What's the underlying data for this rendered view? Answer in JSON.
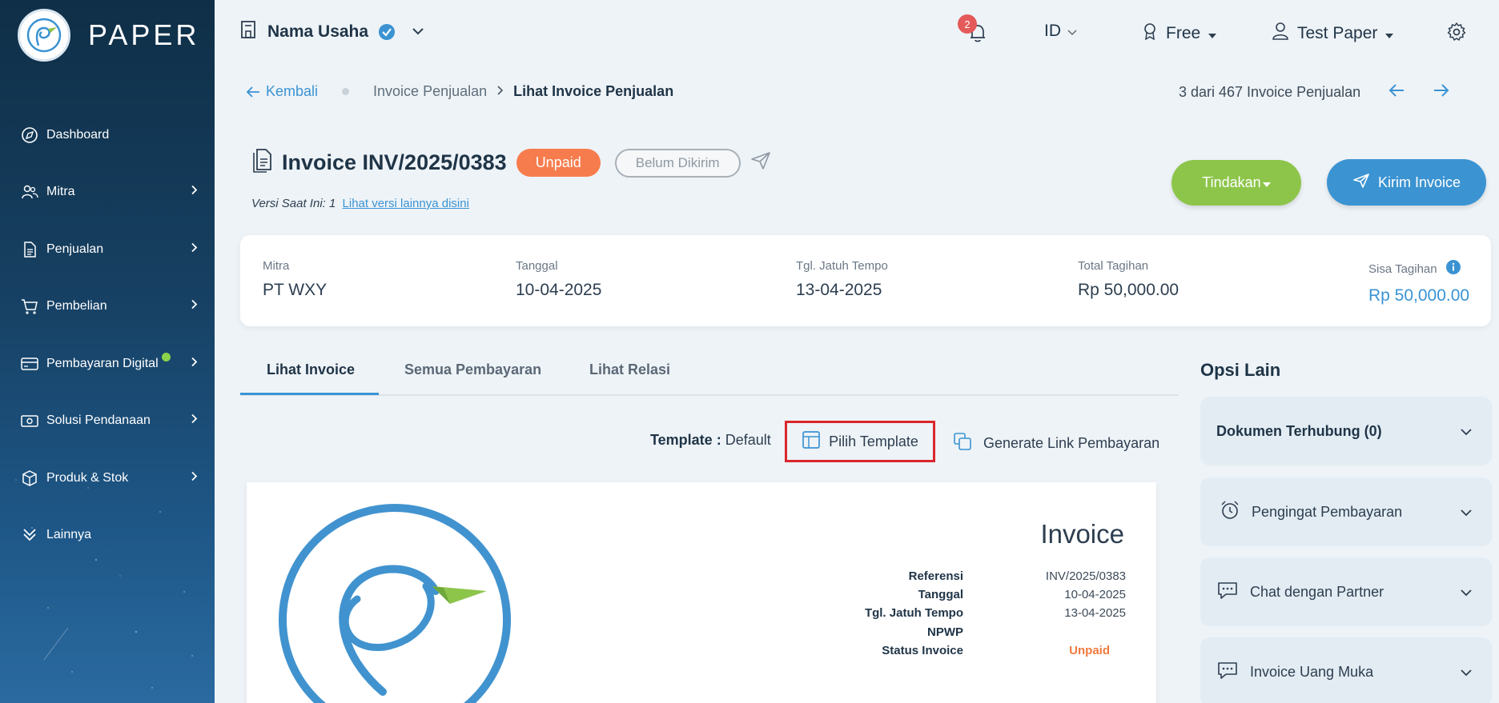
{
  "sidebar": {
    "brand": "PAPER",
    "items": [
      {
        "label": "Dashboard",
        "icon": "compass-icon"
      },
      {
        "label": "Mitra",
        "icon": "users-icon"
      },
      {
        "label": "Penjualan",
        "icon": "document-icon"
      },
      {
        "label": "Pembelian",
        "icon": "cart-icon"
      },
      {
        "label": "Pembayaran Digital",
        "icon": "card-icon"
      },
      {
        "label": "Solusi Pendanaan",
        "icon": "money-icon"
      },
      {
        "label": "Produk & Stok",
        "icon": "box-icon"
      },
      {
        "label": "Lainnya",
        "icon": "double-chevron-down-icon"
      }
    ]
  },
  "header": {
    "business_name": "Nama Usaha",
    "notif_count": "2",
    "language": "ID",
    "plan": "Free",
    "user": "Test Paper"
  },
  "breadcrumb": {
    "back": "Kembali",
    "parent": "Invoice Penjualan",
    "current": "Lihat Invoice Penjualan",
    "pager": "3 dari 467 Invoice Penjualan"
  },
  "invoice": {
    "title": "Invoice INV/2025/0383",
    "status": "Unpaid",
    "send_status": "Belum Dikirim",
    "version_text": "Versi Saat Ini: 1",
    "version_link": "Lihat versi lainnya disini",
    "action_label": "Tindakan",
    "send_label": "Kirim Invoice"
  },
  "summary": {
    "mitra_label": "Mitra",
    "mitra": "PT WXY",
    "date_label": "Tanggal",
    "date": "10-04-2025",
    "due_label": "Tgl. Jatuh Tempo",
    "due": "13-04-2025",
    "total_label": "Total Tagihan",
    "total": "Rp 50,000.00",
    "remaining_label": "Sisa Tagihan",
    "remaining": "Rp 50,000.00"
  },
  "tabs": [
    "Lihat Invoice",
    "Semua Pembayaran",
    "Lihat Relasi"
  ],
  "template": {
    "label": "Template :",
    "value": "Default",
    "pick": "Pilih Template",
    "generate": "Generate Link Pembayaran"
  },
  "preview": {
    "heading": "Invoice",
    "rows": [
      {
        "k": "Referensi",
        "v": "INV/2025/0383"
      },
      {
        "k": "Tanggal",
        "v": "10-04-2025"
      },
      {
        "k": "Tgl. Jatuh Tempo",
        "v": "13-04-2025"
      },
      {
        "k": "NPWP",
        "v": ""
      },
      {
        "k": "Status Invoice",
        "v": "Unpaid"
      }
    ]
  },
  "other_options": {
    "title": "Opsi Lain",
    "items": [
      {
        "label": "Dokumen Terhubung (0)"
      },
      {
        "label": "Pengingat Pembayaran"
      },
      {
        "label": "Chat dengan Partner"
      },
      {
        "label": "Invoice Uang Muka"
      }
    ]
  },
  "colors": {
    "primary": "#3b93d2",
    "success": "#8dc54b",
    "unpaid": "#f77c4d",
    "highlight": "#d9262b"
  }
}
